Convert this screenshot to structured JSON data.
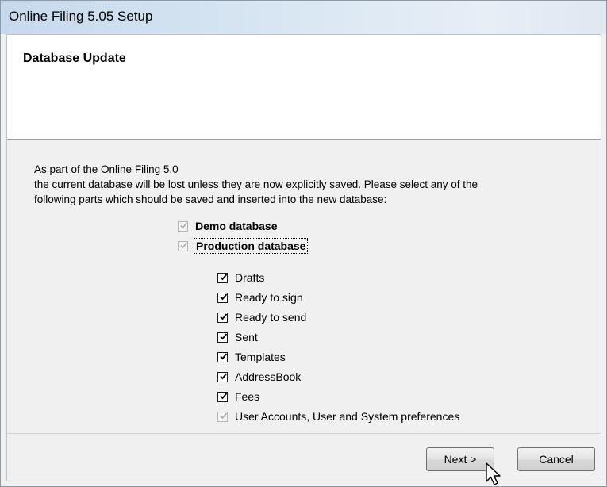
{
  "window": {
    "title": "Online Filing 5.05 Setup"
  },
  "header": {
    "title": "Database Update"
  },
  "intro": {
    "lines": [
      "As part of the Online Filing 5.0",
      "the current database will be lost unless they are now explicitly saved. Please select any of the",
      "following parts which should be saved and inserted into the new database:"
    ]
  },
  "options": {
    "demo_database": {
      "label": "Demo database",
      "checked": true,
      "enabled": false
    },
    "production_database": {
      "label": "Production database",
      "checked": true,
      "enabled": false
    },
    "items": [
      {
        "label": "Drafts",
        "checked": true,
        "enabled": true
      },
      {
        "label": "Ready to sign",
        "checked": true,
        "enabled": true
      },
      {
        "label": "Ready to send",
        "checked": true,
        "enabled": true
      },
      {
        "label": "Sent",
        "checked": true,
        "enabled": true
      },
      {
        "label": "Templates",
        "checked": true,
        "enabled": true
      },
      {
        "label": "AddressBook",
        "checked": true,
        "enabled": true
      },
      {
        "label": "Fees",
        "checked": true,
        "enabled": true
      },
      {
        "label": "User Accounts, User and System preferences",
        "checked": true,
        "enabled": false
      }
    ]
  },
  "buttons": {
    "next": "Next >",
    "cancel": "Cancel"
  },
  "colors": {
    "check_enabled": "#000000",
    "check_disabled": "#a8a8a8",
    "title_gradient_start": "#c7d9ec"
  },
  "icons": {
    "check": "checkmark-icon",
    "cursor": "mouse-pointer-icon"
  }
}
